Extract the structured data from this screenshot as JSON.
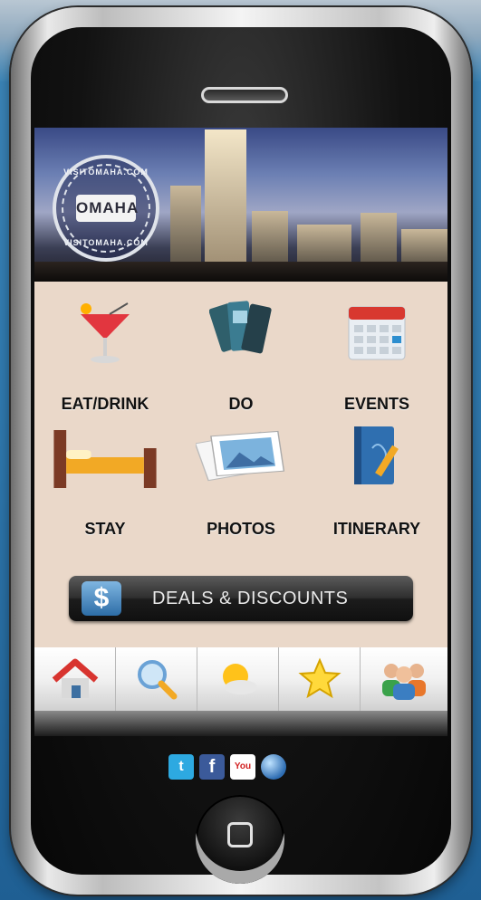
{
  "app": {
    "seal": {
      "text_top": "VISITOMAHA.COM",
      "text_center": "OMAHA",
      "text_bottom": "VISITOMAHA.COM"
    }
  },
  "menu": {
    "items": [
      {
        "label": "EAT/DRINK",
        "icon": "cocktail-icon"
      },
      {
        "label": "DO",
        "icon": "tickets-icon"
      },
      {
        "label": "EVENTS",
        "icon": "calendar-icon"
      },
      {
        "label": "STAY",
        "icon": "bed-icon"
      },
      {
        "label": "PHOTOS",
        "icon": "photos-icon"
      },
      {
        "label": "ITINERARY",
        "icon": "notebook-icon"
      }
    ],
    "deals": {
      "label": "DEALS & DISCOUNTS",
      "icon_text": "$"
    }
  },
  "tabbar": {
    "items": [
      "home-icon",
      "search-icon",
      "weather-icon",
      "favorites-icon",
      "people-icon"
    ]
  },
  "social": {
    "items": [
      {
        "icon": "twitter-icon",
        "glyph": "t"
      },
      {
        "icon": "facebook-icon",
        "glyph": "f"
      },
      {
        "icon": "youtube-icon",
        "glyph": "You"
      },
      {
        "icon": "globe-icon",
        "glyph": ""
      }
    ]
  },
  "colors": {
    "screen_bg": "#ead8c9",
    "deals_bg": "#1c1c1c",
    "accent_blue": "#2d6da7"
  }
}
